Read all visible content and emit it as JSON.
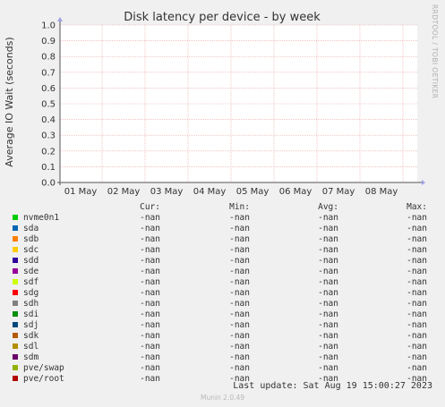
{
  "chart_data": {
    "type": "line",
    "title": "Disk latency per device - by week",
    "ylabel": "Average IO Wait (seconds)",
    "side_label": "RRDTOOL / TOBI OETIKER",
    "ylim": [
      0,
      1.0
    ],
    "y_ticks": [
      "0.0",
      "0.1",
      "0.2",
      "0.3",
      "0.4",
      "0.5",
      "0.6",
      "0.7",
      "0.8",
      "0.9",
      "1.0"
    ],
    "x_ticks": [
      "01 May",
      "02 May",
      "03 May",
      "04 May",
      "05 May",
      "06 May",
      "07 May",
      "08 May"
    ],
    "grid": true,
    "series": []
  },
  "legend": {
    "headers": {
      "cur": "Cur:",
      "min": "Min:",
      "avg": "Avg:",
      "max": "Max:"
    },
    "rows": [
      {
        "name": "nvme0n1",
        "color": "#00cc00",
        "cur": "-nan",
        "min": "-nan",
        "avg": "-nan",
        "max": "-nan"
      },
      {
        "name": "sda",
        "color": "#0066b3",
        "cur": "-nan",
        "min": "-nan",
        "avg": "-nan",
        "max": "-nan"
      },
      {
        "name": "sdb",
        "color": "#ff8000",
        "cur": "-nan",
        "min": "-nan",
        "avg": "-nan",
        "max": "-nan"
      },
      {
        "name": "sdc",
        "color": "#ffcc00",
        "cur": "-nan",
        "min": "-nan",
        "avg": "-nan",
        "max": "-nan"
      },
      {
        "name": "sdd",
        "color": "#330099",
        "cur": "-nan",
        "min": "-nan",
        "avg": "-nan",
        "max": "-nan"
      },
      {
        "name": "sde",
        "color": "#990099",
        "cur": "-nan",
        "min": "-nan",
        "avg": "-nan",
        "max": "-nan"
      },
      {
        "name": "sdf",
        "color": "#ccff00",
        "cur": "-nan",
        "min": "-nan",
        "avg": "-nan",
        "max": "-nan"
      },
      {
        "name": "sdg",
        "color": "#ff0000",
        "cur": "-nan",
        "min": "-nan",
        "avg": "-nan",
        "max": "-nan"
      },
      {
        "name": "sdh",
        "color": "#808080",
        "cur": "-nan",
        "min": "-nan",
        "avg": "-nan",
        "max": "-nan"
      },
      {
        "name": "sdi",
        "color": "#008f00",
        "cur": "-nan",
        "min": "-nan",
        "avg": "-nan",
        "max": "-nan"
      },
      {
        "name": "sdj",
        "color": "#00487d",
        "cur": "-nan",
        "min": "-nan",
        "avg": "-nan",
        "max": "-nan"
      },
      {
        "name": "sdk",
        "color": "#b35a00",
        "cur": "-nan",
        "min": "-nan",
        "avg": "-nan",
        "max": "-nan"
      },
      {
        "name": "sdl",
        "color": "#b38f00",
        "cur": "-nan",
        "min": "-nan",
        "avg": "-nan",
        "max": "-nan"
      },
      {
        "name": "sdm",
        "color": "#6b006b",
        "cur": "-nan",
        "min": "-nan",
        "avg": "-nan",
        "max": "-nan"
      },
      {
        "name": "pve/swap",
        "color": "#8fb300",
        "cur": "-nan",
        "min": "-nan",
        "avg": "-nan",
        "max": "-nan"
      },
      {
        "name": "pve/root",
        "color": "#b30000",
        "cur": "-nan",
        "min": "-nan",
        "avg": "-nan",
        "max": "-nan"
      }
    ]
  },
  "footer": {
    "last_update": "Last update: Sat Aug 19 15:00:27 2023",
    "version": "Munin 2.0.49"
  }
}
